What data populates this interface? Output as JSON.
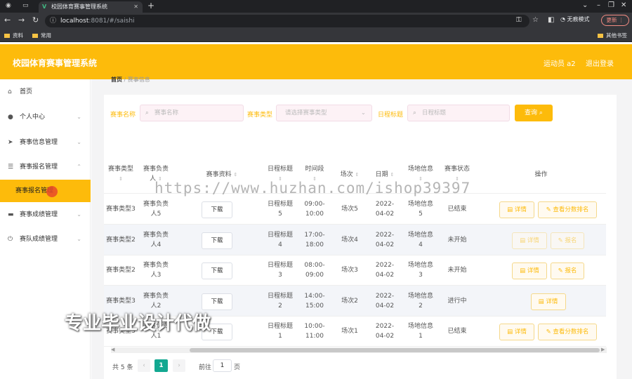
{
  "browser": {
    "tab_title": "校园体育赛事管理系统",
    "url_host": "localhost",
    "url_path": ":8081/#/saishi",
    "profile_label": "无痕模式",
    "update_label": "更新",
    "bookmarks": [
      "资料",
      "常用"
    ],
    "bookmark_right": "其他书签"
  },
  "header": {
    "title": "校园体育赛事管理系统",
    "user": "运动员 a2",
    "logout": "退出登录"
  },
  "sidebar": {
    "items": [
      {
        "label": "首页",
        "icon": "home-icon"
      },
      {
        "label": "个人中心",
        "icon": "user-icon"
      },
      {
        "label": "赛事信息管理",
        "icon": "send-icon"
      },
      {
        "label": "赛事报名管理",
        "icon": "list-icon"
      },
      {
        "label": "赛事成绩管理",
        "icon": "monitor-icon"
      },
      {
        "label": "赛队成绩管理",
        "icon": "power-icon"
      }
    ],
    "active_sub": "赛事报名管理"
  },
  "breadcrumb": {
    "home": "首页",
    "sep": "/",
    "current": "赛事信息"
  },
  "filters": {
    "name_label": "赛事名称",
    "name_placeholder": "赛事名称",
    "type_label": "赛事类型",
    "type_placeholder": "请选择赛事类型",
    "schedule_label": "日程标题",
    "schedule_placeholder": "日程标题",
    "query_label": "查询"
  },
  "table": {
    "headers": [
      "赛事类型",
      "赛事负责人",
      "赛事资料",
      "日程标题",
      "时间段",
      "场次",
      "日期",
      "场地信息",
      "赛事状态",
      "操作"
    ],
    "rows": [
      {
        "type": "赛事类型3",
        "lead": "赛事负责人5",
        "material": "下载",
        "schedule": "日程标题5",
        "time": "09:00-10:00",
        "session": "场次5",
        "date": "2022-04-02",
        "venue": "场地信息5",
        "status": "已结束",
        "ops": [
          "详情",
          "查看分数排名"
        ]
      },
      {
        "type": "赛事类型2",
        "lead": "赛事负责人4",
        "material": "下载",
        "schedule": "日程标题4",
        "time": "17:00-18:00",
        "session": "场次4",
        "date": "2022-04-02",
        "venue": "场地信息4",
        "status": "未开始",
        "ops": [
          "详情",
          "报名"
        ]
      },
      {
        "type": "赛事类型2",
        "lead": "赛事负责人3",
        "material": "下载",
        "schedule": "日程标题3",
        "time": "08:00-09:00",
        "session": "场次3",
        "date": "2022-04-02",
        "venue": "场地信息3",
        "status": "未开始",
        "ops": [
          "详情",
          "报名"
        ]
      },
      {
        "type": "赛事类型3",
        "lead": "赛事负责人2",
        "material": "下载",
        "schedule": "日程标题2",
        "time": "14:00-15:00",
        "session": "场次2",
        "date": "2022-04-02",
        "venue": "场地信息2",
        "status": "进行中",
        "ops": [
          "详情"
        ]
      },
      {
        "type": "赛事类型3",
        "lead": "赛事负责人1",
        "material": "下载",
        "schedule": "日程标题1",
        "time": "10:00-11:00",
        "session": "场次1",
        "date": "2022-04-02",
        "venue": "场地信息1",
        "status": "已结束",
        "ops": [
          "详情",
          "查看分数排名"
        ]
      }
    ]
  },
  "pagination": {
    "total": "共 5 条",
    "current": "1",
    "goto_label": "前往",
    "goto_value": "1",
    "page_suffix": "页"
  },
  "overlay": {
    "watermark": "https://www.huzhan.com/ishop39397",
    "promo": "专业毕业设计代做"
  }
}
